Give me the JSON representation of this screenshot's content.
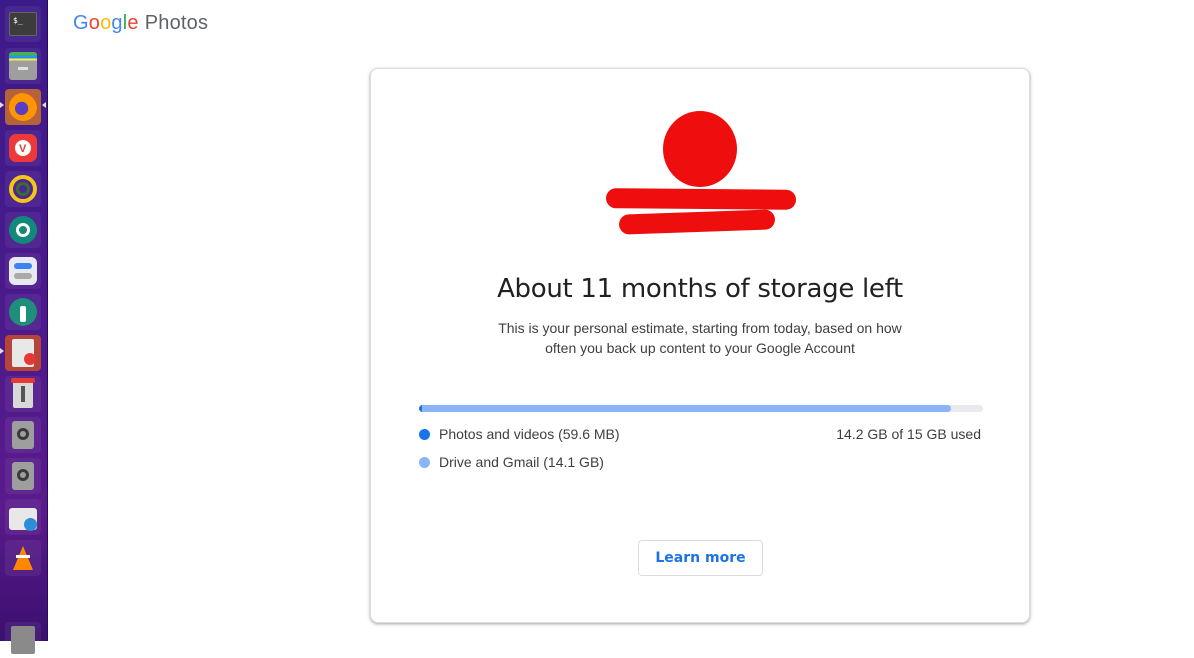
{
  "dock": {
    "items": [
      {
        "name": "terminal",
        "icon": "terminal-icon"
      },
      {
        "name": "files",
        "icon": "file-cabinet-icon"
      },
      {
        "name": "firefox",
        "icon": "firefox-icon",
        "active": true
      },
      {
        "name": "vivaldi",
        "icon": "vivaldi-icon"
      },
      {
        "name": "sync",
        "icon": "sync-icon"
      },
      {
        "name": "aperture",
        "icon": "aperture-icon"
      },
      {
        "name": "settings-toggle",
        "icon": "toggle-settings-icon"
      },
      {
        "name": "gear-tools",
        "icon": "gear-wrench-icon"
      },
      {
        "name": "text-editor",
        "icon": "document-edit-icon"
      },
      {
        "name": "installer",
        "icon": "package-installer-icon"
      },
      {
        "name": "disk-1",
        "icon": "disk-icon"
      },
      {
        "name": "disk-2",
        "icon": "disk-icon"
      },
      {
        "name": "software-store",
        "icon": "briefcase-download-icon"
      },
      {
        "name": "vlc",
        "icon": "vlc-cone-icon"
      },
      {
        "name": "trash",
        "icon": "trash-icon"
      }
    ]
  },
  "header": {
    "brand_letters": [
      "G",
      "o",
      "o",
      "g",
      "l",
      "e"
    ],
    "product": "Photos"
  },
  "card": {
    "headline": "About 11 months of storage left",
    "subtext": "This is your personal estimate, starting from today, based on how often you back up content to your Google Account",
    "storage": {
      "used_label": "14.2 GB of 15 GB used",
      "used_gb": 14.2,
      "total_gb": 15,
      "segments": [
        {
          "label": "Photos and videos (59.6 MB)",
          "gb": 0.0596,
          "color": "#1a73e8"
        },
        {
          "label": "Drive and Gmail (14.1 GB)",
          "gb": 14.1,
          "color": "#8ab4f8"
        }
      ]
    },
    "learn_more": "Learn more",
    "redaction_color": "#ee0e0e"
  }
}
